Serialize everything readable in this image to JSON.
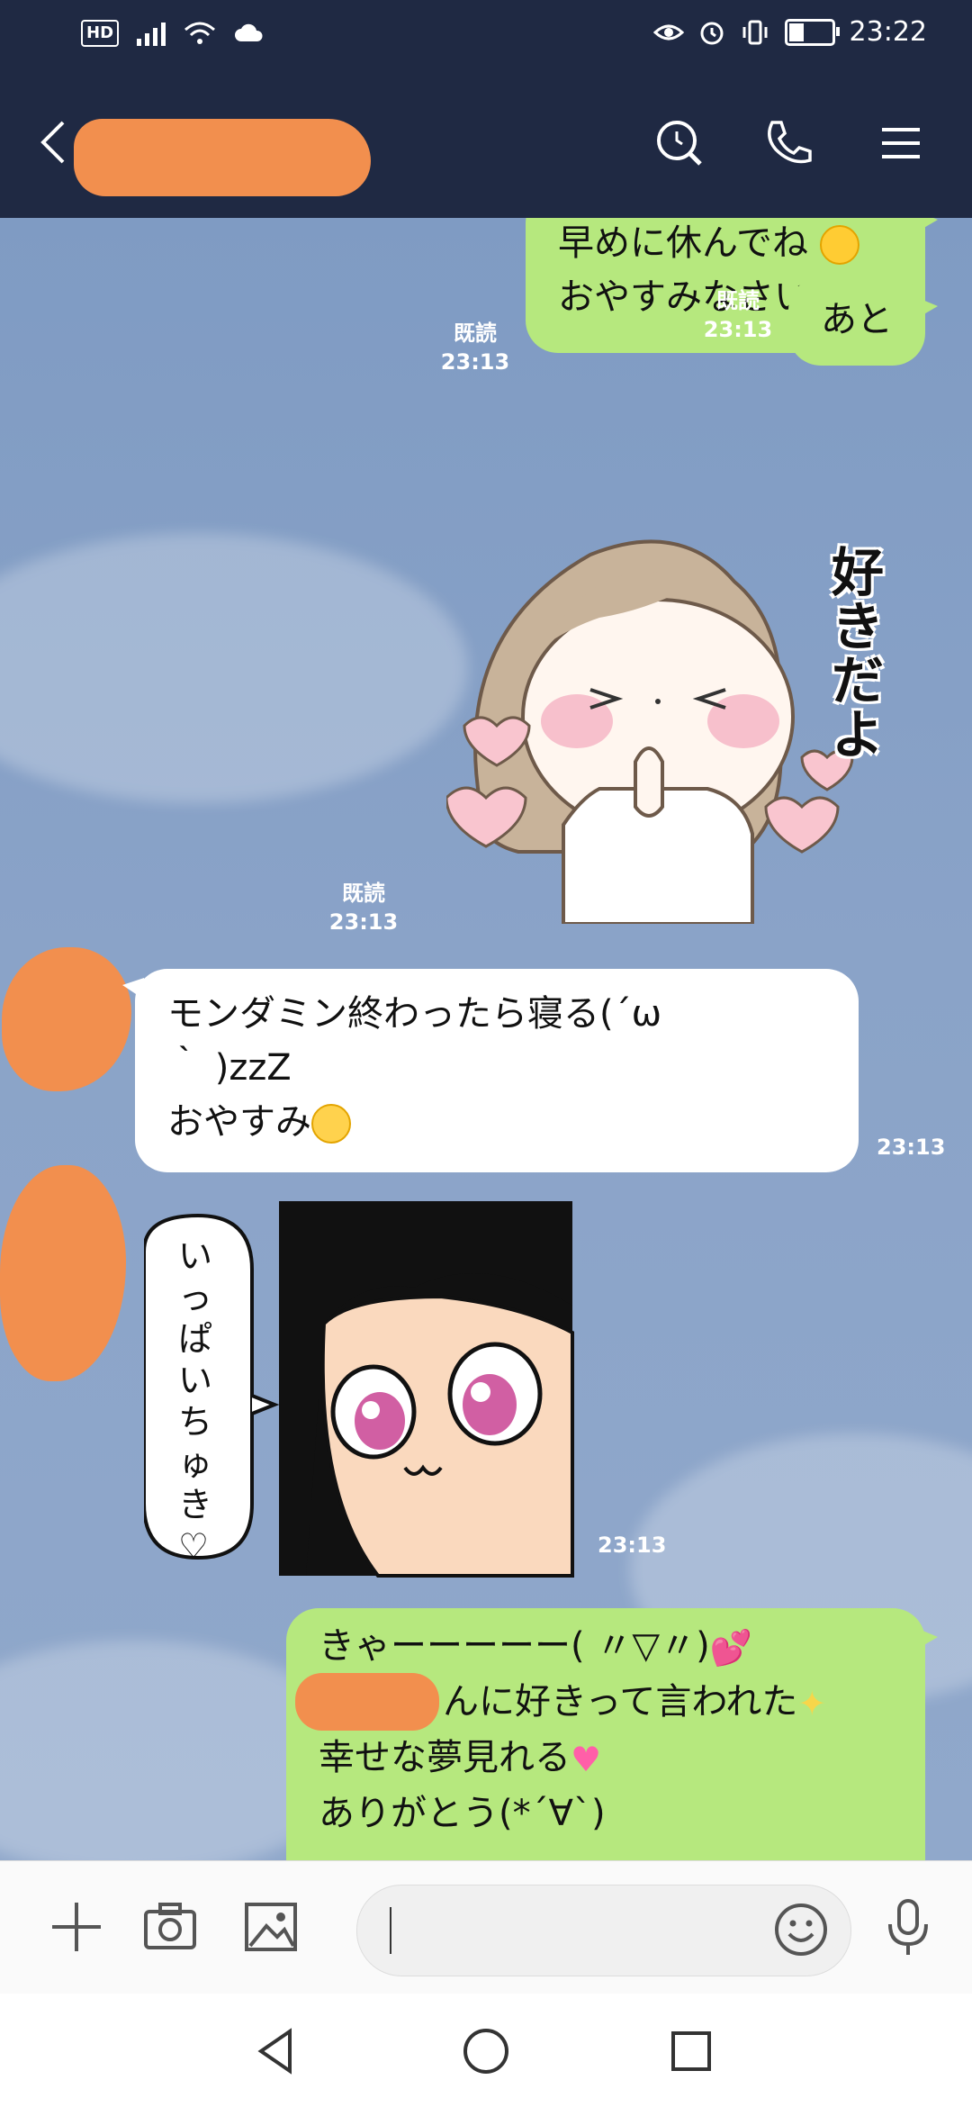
{
  "status_bar": {
    "hd": "HD",
    "time": "23:22"
  },
  "header": {
    "contact_name": ""
  },
  "messages": {
    "m1": {
      "lines": [
        "早めに休んでね",
        "",
        "おやすみなさい"
      ],
      "read": "既読",
      "time": "23:13"
    },
    "m2": {
      "text": "あと",
      "read": "既読",
      "time": "23:13"
    },
    "m3": {
      "sticker_text": "好きだよ",
      "read": "既読",
      "time": "23:13"
    },
    "m4": {
      "lines": [
        "モンダミン終わったら寝る(´ω",
        "｀ )zzZ",
        "おやすみ"
      ],
      "time": "23:13"
    },
    "m5": {
      "sticker_text": "いっぱいちゅき♡",
      "time": "23:13"
    },
    "m6": {
      "lines": [
        "きゃーーーーー( 〃▽〃)",
        "んに好きって言われた",
        "幸せな夢見れる",
        "ありがとう(*´∀`)"
      ]
    }
  },
  "input": {
    "placeholder": ""
  },
  "colors": {
    "header_bg": "#1f2943",
    "outgoing_bubble": "#b6e87e",
    "incoming_bubble": "#ffffff",
    "chat_bg": "#849fc6",
    "redaction": "#f28f4e"
  },
  "icons": [
    "back-icon",
    "search-icon",
    "phone-icon",
    "menu-icon",
    "plus-icon",
    "camera-icon",
    "image-icon",
    "emoji-icon",
    "microphone-icon",
    "nav-back-icon",
    "nav-home-icon",
    "nav-recents-icon"
  ]
}
